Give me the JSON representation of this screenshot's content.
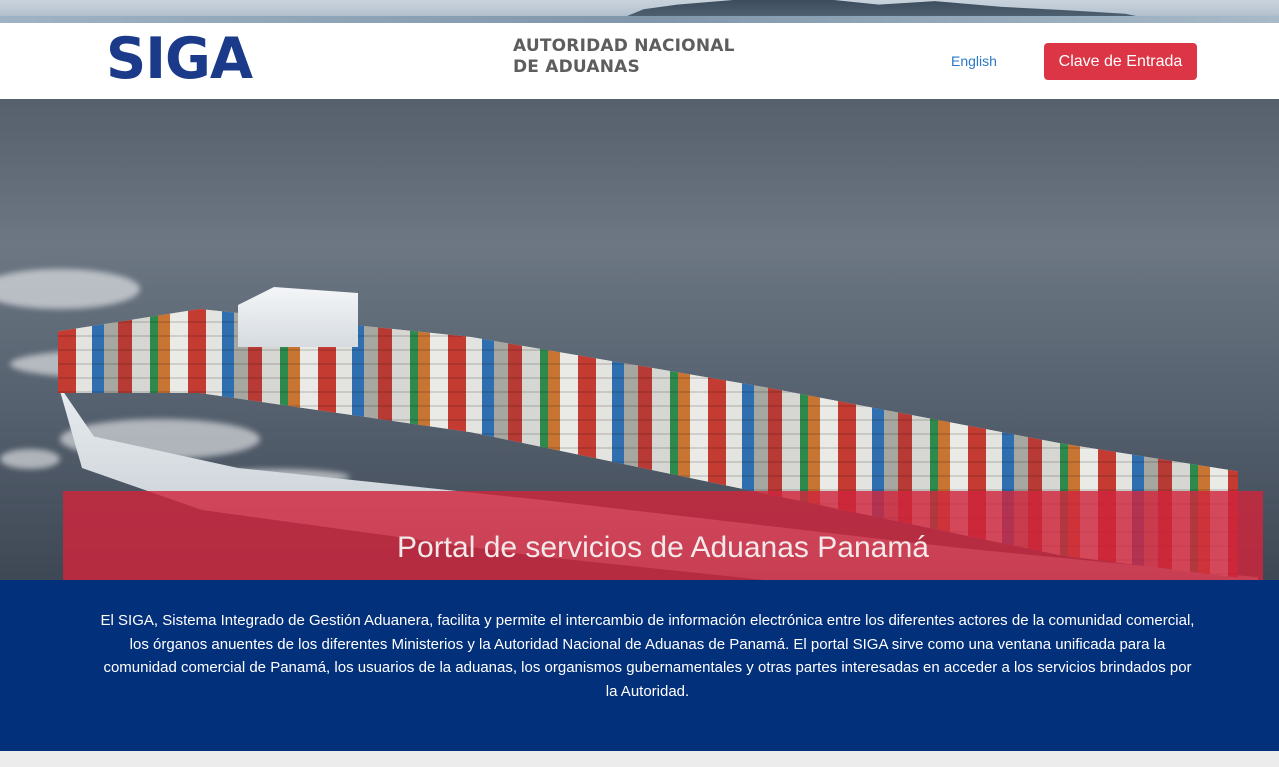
{
  "header": {
    "logo_text": "SIGA",
    "agency_line1": "AUTORIDAD NACIONAL",
    "agency_line2": "DE ADUANAS",
    "language_link": "English",
    "login_button": "Clave de Entrada"
  },
  "hero": {
    "title": "Portal de servicios de Aduanas Panamá"
  },
  "description": {
    "text": "El SIGA, Sistema Integrado de Gestión Aduanera, facilita y permite el intercambio de información electrónica entre los diferentes actores de la comunidad comercial, los órganos anuentes de los diferentes Ministerios y la Autoridad Nacional de Aduanas de Panamá. El portal SIGA sirve como una ventana unificada para la comunidad comercial de Panamá, los usuarios de la aduanas, los organismos gubernamentales y otras partes interesadas en acceder a los servicios brindados por la Autoridad."
  },
  "colors": {
    "brand_blue": "#1b3a8a",
    "login_red": "#dc3545",
    "banner_red": "#cf253c",
    "section_navy": "#03307b",
    "link_blue": "#2a7ac8"
  }
}
